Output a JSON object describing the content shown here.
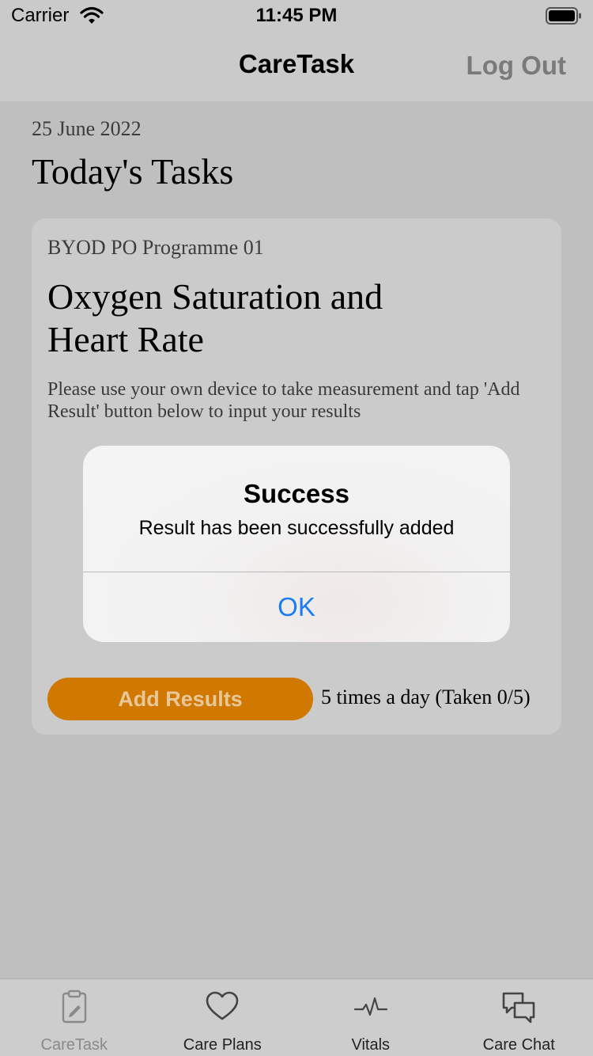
{
  "status_bar": {
    "carrier": "Carrier",
    "time": "11:45 PM"
  },
  "nav": {
    "title": "CareTask",
    "logout_label": "Log Out"
  },
  "content": {
    "date": "25 June 2022",
    "section_title": "Today's Tasks",
    "task": {
      "program": "BYOD PO Programme 01",
      "title": "Oxygen Saturation and Heart Rate",
      "description": "Please use your own device to take measurement and tap 'Add Result' button below to input your results",
      "add_button_label": "Add Results",
      "frequency": "5 times a day (Taken 0/5)"
    }
  },
  "alert": {
    "title": "Success",
    "message": "Result has been successfully added",
    "ok_label": "OK"
  },
  "tab_bar": {
    "items": [
      {
        "label": "CareTask",
        "icon": "clipboard-edit-icon",
        "active": true
      },
      {
        "label": "Care Plans",
        "icon": "heart-icon",
        "active": false
      },
      {
        "label": "Vitals",
        "icon": "pulse-icon",
        "active": false
      },
      {
        "label": "Care Chat",
        "icon": "chat-bubbles-icon",
        "active": false
      }
    ]
  },
  "colors": {
    "accent_orange": "#d17800",
    "link_blue": "#1a7df0"
  }
}
